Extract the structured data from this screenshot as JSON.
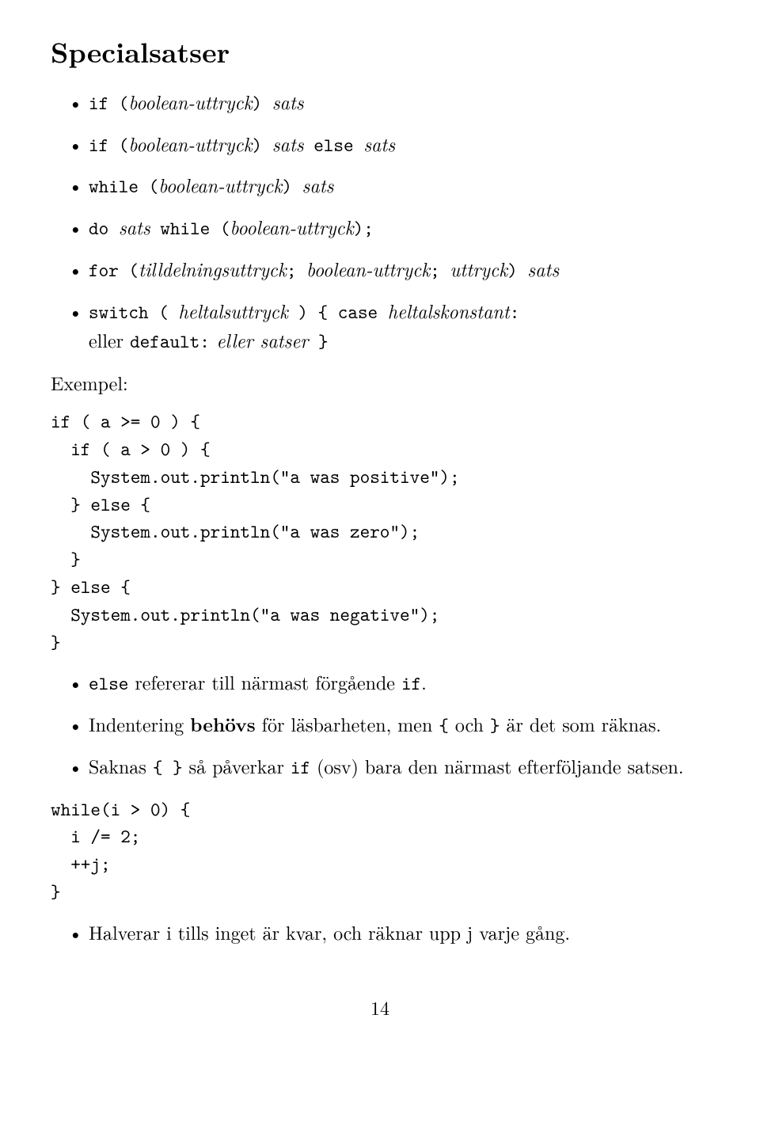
{
  "heading": "Specialsatser",
  "top_bullets": [
    {
      "segments": [
        {
          "text": "if (",
          "cls": "tt"
        },
        {
          "text": "boolean-uttryck",
          "cls": "italic"
        },
        {
          "text": ") ",
          "cls": "tt"
        },
        {
          "text": "sats",
          "cls": "italic"
        }
      ]
    },
    {
      "segments": [
        {
          "text": "if (",
          "cls": "tt"
        },
        {
          "text": "boolean-uttryck",
          "cls": "italic"
        },
        {
          "text": ") ",
          "cls": "tt"
        },
        {
          "text": "sats",
          "cls": "italic"
        },
        {
          "text": " else ",
          "cls": "tt"
        },
        {
          "text": "sats",
          "cls": "italic"
        }
      ]
    },
    {
      "segments": [
        {
          "text": "while (",
          "cls": "tt"
        },
        {
          "text": "boolean-uttryck",
          "cls": "italic"
        },
        {
          "text": ") ",
          "cls": "tt"
        },
        {
          "text": "sats",
          "cls": "italic"
        }
      ]
    },
    {
      "segments": [
        {
          "text": "do ",
          "cls": "tt"
        },
        {
          "text": "sats",
          "cls": "italic"
        },
        {
          "text": " while (",
          "cls": "tt"
        },
        {
          "text": "boolean-uttryck",
          "cls": "italic"
        },
        {
          "text": ");",
          "cls": "tt"
        }
      ]
    },
    {
      "segments": [
        {
          "text": "for (",
          "cls": "tt"
        },
        {
          "text": "tilldelningsuttryck",
          "cls": "italic"
        },
        {
          "text": "; ",
          "cls": "tt"
        },
        {
          "text": "boolean-uttryck",
          "cls": "italic"
        },
        {
          "text": "; ",
          "cls": "tt"
        },
        {
          "text": "uttryck",
          "cls": "italic"
        },
        {
          "text": ") ",
          "cls": "tt"
        },
        {
          "text": "sats",
          "cls": "italic"
        }
      ]
    },
    {
      "segments": [
        {
          "text": "switch ( ",
          "cls": "tt"
        },
        {
          "text": "heltalsuttryck",
          "cls": "italic"
        },
        {
          "text": " ) { case ",
          "cls": "tt"
        },
        {
          "text": "heltalskonstant",
          "cls": "italic"
        },
        {
          "text": ":",
          "cls": "tt"
        },
        {
          "text": "\neller ",
          "cls": ""
        },
        {
          "text": "default:",
          "cls": "tt"
        },
        {
          "text": " eller ",
          "cls": "italic"
        },
        {
          "text": "satser",
          "cls": "italic"
        },
        {
          "text": " }",
          "cls": "tt"
        }
      ]
    }
  ],
  "exempel_label": "Exempel:",
  "code1": "if ( a >= 0 ) {\n  if ( a > 0 ) {\n    System.out.println(\"a was positive\");\n  } else {\n    System.out.println(\"a was zero\");\n  }\n} else {\n  System.out.println(\"a was negative\");\n}",
  "mid_bullets": [
    {
      "segments": [
        {
          "text": "else",
          "cls": "tt"
        },
        {
          "text": " refererar till närmast förgående ",
          "cls": ""
        },
        {
          "text": "if",
          "cls": "tt"
        },
        {
          "text": ".",
          "cls": ""
        }
      ]
    },
    {
      "segments": [
        {
          "text": "Indentering ",
          "cls": ""
        },
        {
          "text": "behövs",
          "cls": "bold"
        },
        {
          "text": " för läsbarheten, men ",
          "cls": ""
        },
        {
          "text": "{",
          "cls": "tt"
        },
        {
          "text": " och ",
          "cls": ""
        },
        {
          "text": "}",
          "cls": "tt"
        },
        {
          "text": " är det som räknas.",
          "cls": ""
        }
      ]
    },
    {
      "segments": [
        {
          "text": "Saknas ",
          "cls": ""
        },
        {
          "text": "{ }",
          "cls": "tt"
        },
        {
          "text": " så påverkar ",
          "cls": ""
        },
        {
          "text": "if",
          "cls": "tt"
        },
        {
          "text": " (osv) bara den närmast efterföljande satsen.",
          "cls": ""
        }
      ]
    }
  ],
  "code2": "while(i > 0) {\n  i /= 2;\n  ++j;\n}",
  "bottom_bullets": [
    {
      "segments": [
        {
          "text": "Halverar i tills inget är kvar, och räknar upp j varje gång.",
          "cls": ""
        }
      ]
    }
  ],
  "page_number": "14"
}
